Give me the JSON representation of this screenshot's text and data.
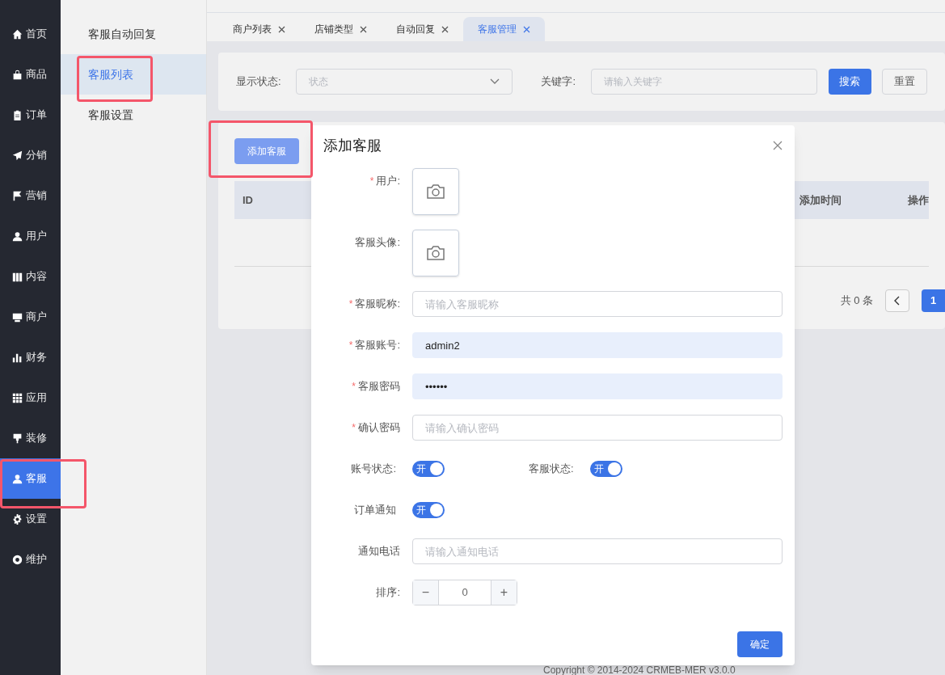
{
  "sidebar": {
    "items": [
      {
        "label": "首页",
        "selected": false
      },
      {
        "label": "商品",
        "selected": false
      },
      {
        "label": "订单",
        "selected": false
      },
      {
        "label": "分销",
        "selected": false
      },
      {
        "label": "营销",
        "selected": false
      },
      {
        "label": "用户",
        "selected": false
      },
      {
        "label": "内容",
        "selected": false
      },
      {
        "label": "商户",
        "selected": false
      },
      {
        "label": "财务",
        "selected": false
      },
      {
        "label": "应用",
        "selected": false
      },
      {
        "label": "装修",
        "selected": false
      },
      {
        "label": "客服",
        "selected": true
      },
      {
        "label": "设置",
        "selected": false
      },
      {
        "label": "维护",
        "selected": false
      }
    ]
  },
  "submenu": {
    "items": [
      {
        "label": "客服自动回复",
        "selected": false
      },
      {
        "label": "客服列表",
        "selected": true
      },
      {
        "label": "客服设置",
        "selected": false
      }
    ]
  },
  "tabs": [
    {
      "label": "商户列表",
      "selected": false
    },
    {
      "label": "店铺类型",
      "selected": false
    },
    {
      "label": "自动回复",
      "selected": false
    },
    {
      "label": "客服管理",
      "selected": true
    }
  ],
  "filters": {
    "status_label": "显示状态:",
    "status_placeholder": "状态",
    "keyword_label": "关键字:",
    "keyword_placeholder": "请输入关键字",
    "search_button": "搜索",
    "reset_button": "重置"
  },
  "add_button": "添加客服",
  "table": {
    "columns": [
      "ID",
      "添加时间",
      "操作"
    ]
  },
  "pagination": {
    "total": "共 0 条",
    "page": "1"
  },
  "footer": "Copyright © 2014-2024 CRMEB-MER v3.0.0",
  "dialog": {
    "title": "添加客服",
    "fields": [
      {
        "kind": "upload",
        "label": "用户:",
        "mark": "*"
      },
      {
        "kind": "upload",
        "label": "客服头像:"
      },
      {
        "kind": "input",
        "label": "客服昵称:",
        "mark": "*",
        "placeholder": "请输入客服昵称"
      },
      {
        "kind": "input",
        "label": "客服账号:",
        "mark": "*",
        "value": "admin2",
        "filled": true
      },
      {
        "kind": "input",
        "label": "客服密码",
        "mark": "*",
        "value": "••••••",
        "filled": true
      },
      {
        "kind": "input",
        "label": "确认密码",
        "mark": "*",
        "placeholder": "请输入确认密码"
      },
      {
        "kind": "toggles",
        "items": [
          {
            "label": "账号状态:",
            "on": true,
            "text": "开"
          },
          {
            "label": "客服状态:",
            "on": true,
            "text": "开"
          }
        ]
      },
      {
        "kind": "toggles",
        "items": [
          {
            "label": "订单通知",
            "on": true,
            "text": "开"
          }
        ]
      },
      {
        "kind": "input",
        "label": "通知电话",
        "placeholder": "请输入通知电话"
      },
      {
        "kind": "number",
        "label": "排序:",
        "value": "0",
        "minus": "−",
        "plus": "+"
      }
    ],
    "confirm_button": "确定"
  }
}
